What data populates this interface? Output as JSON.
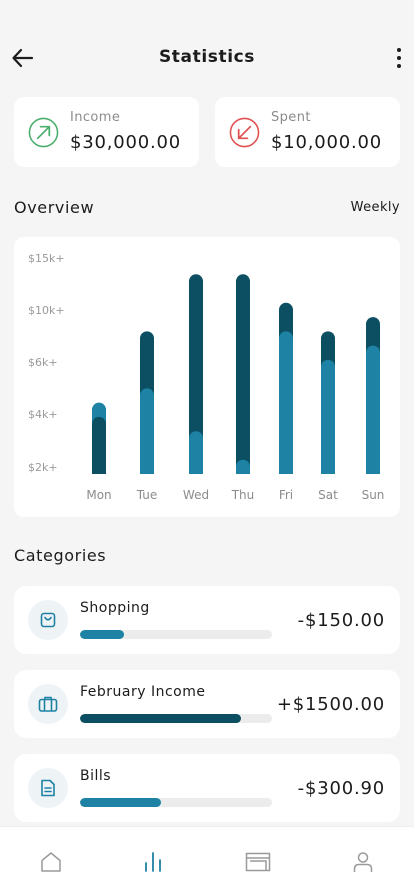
{
  "header": {
    "title": "Statistics"
  },
  "summary": {
    "income": {
      "label": "Income",
      "value": "$30,000.00"
    },
    "spent": {
      "label": "Spent",
      "value": "$10,000.00"
    }
  },
  "overview": {
    "title": "Overview",
    "period": "Weekly"
  },
  "colors": {
    "dark": "#0c4f63",
    "light": "#1d82a3",
    "income": "#4caf6e",
    "spent": "#e05252",
    "track": "#ececec",
    "icon": "#1d82a3"
  },
  "chart_data": {
    "type": "bar",
    "categories": [
      "Mon",
      "Tue",
      "Wed",
      "Thu",
      "Fri",
      "Sat",
      "Sun"
    ],
    "y_ticks": [
      "$15k+",
      "$10k+",
      "$6k+",
      "$4k+",
      "$2k+"
    ],
    "series": [
      {
        "values": [
          4,
          10,
          14,
          14,
          12,
          10,
          11
        ]
      },
      {
        "values": [
          5,
          6,
          3,
          1,
          10,
          8,
          9
        ]
      }
    ],
    "ylim": [
      0,
      15
    ],
    "grid": false,
    "legend": "none"
  },
  "categories": {
    "title": "Categories",
    "items": [
      {
        "name": "Shopping",
        "amount": "-$150.00",
        "progress": 0.23,
        "color": "#1d82a3",
        "icon": "shopping-bag-icon"
      },
      {
        "name": "February Income",
        "amount": "+$1500.00",
        "progress": 0.84,
        "color": "#0c4f63",
        "icon": "briefcase-icon"
      },
      {
        "name": "Bills",
        "amount": "-$300.90",
        "progress": 0.42,
        "color": "#1d82a3",
        "icon": "document-icon"
      }
    ]
  },
  "tabbar": {
    "active": "stats"
  }
}
